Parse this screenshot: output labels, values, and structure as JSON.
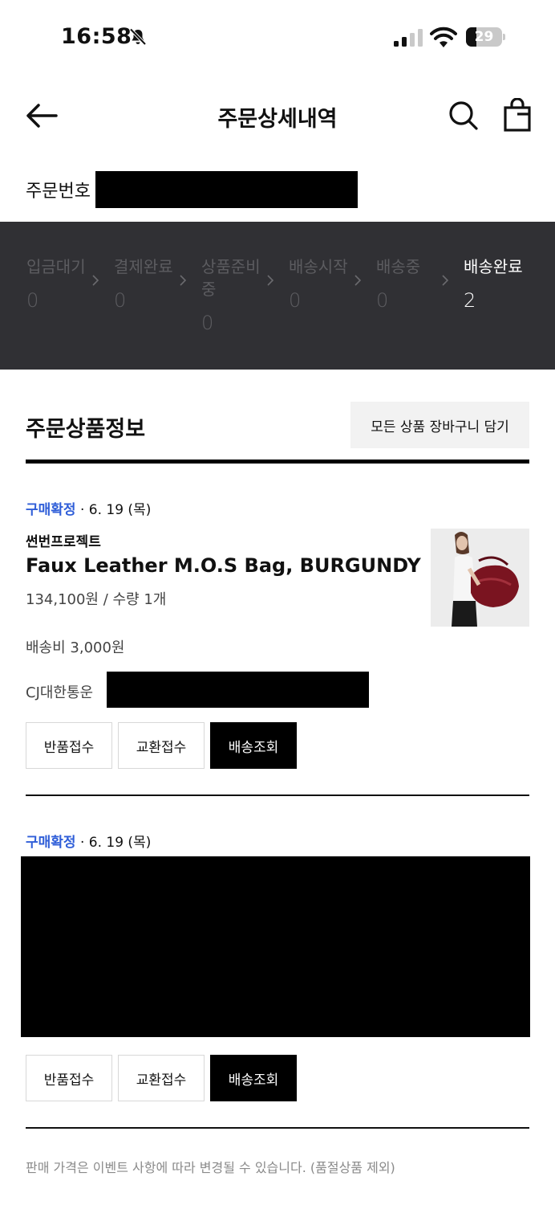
{
  "status_bar": {
    "time": "16:58",
    "battery_level": "29",
    "battery_fraction": 0.29
  },
  "header": {
    "title": "주문상세내역",
    "back_icon": "arrow-left-icon",
    "search_icon": "search-icon",
    "bag_icon": "shopping-bag-icon"
  },
  "order": {
    "number_label": "주문번호"
  },
  "progress": {
    "steps": [
      {
        "label": "입금대기",
        "count": "0"
      },
      {
        "label": "결제완료",
        "count": "0"
      },
      {
        "label": "상품준비중",
        "count": "0"
      },
      {
        "label": "배송시작",
        "count": "0"
      },
      {
        "label": "배송중",
        "count": "0"
      },
      {
        "label": "배송완료",
        "count": "2"
      }
    ]
  },
  "section": {
    "title": "주문상품정보",
    "add_all_button": "모든 상품 장바구니 담기"
  },
  "items": [
    {
      "status": "구매확정",
      "date": " · 6. 19 (목)",
      "brand": "썬번프로젝트",
      "name": "Faux Leather M.O.S Bag, BURGUNDY",
      "price_qty": "134,100원 / 수량 1개",
      "shipping_fee": "배송비 3,000원",
      "carrier": "CJ대한통운",
      "buttons": [
        "반품접수",
        "교환접수",
        "배송조회"
      ]
    },
    {
      "status": "구매확정",
      "date": " · 6. 19 (목)",
      "buttons": [
        "반품접수",
        "교환접수",
        "배송조회"
      ]
    }
  ],
  "footnote": "판매 가격은 이벤트 사항에 따라 변경될 수 있습니다. (품절상품 제외)",
  "colors": {
    "accent_blue": "#2f5ed8",
    "progress_bg": "#303034",
    "bag_color": "#7a1420"
  }
}
